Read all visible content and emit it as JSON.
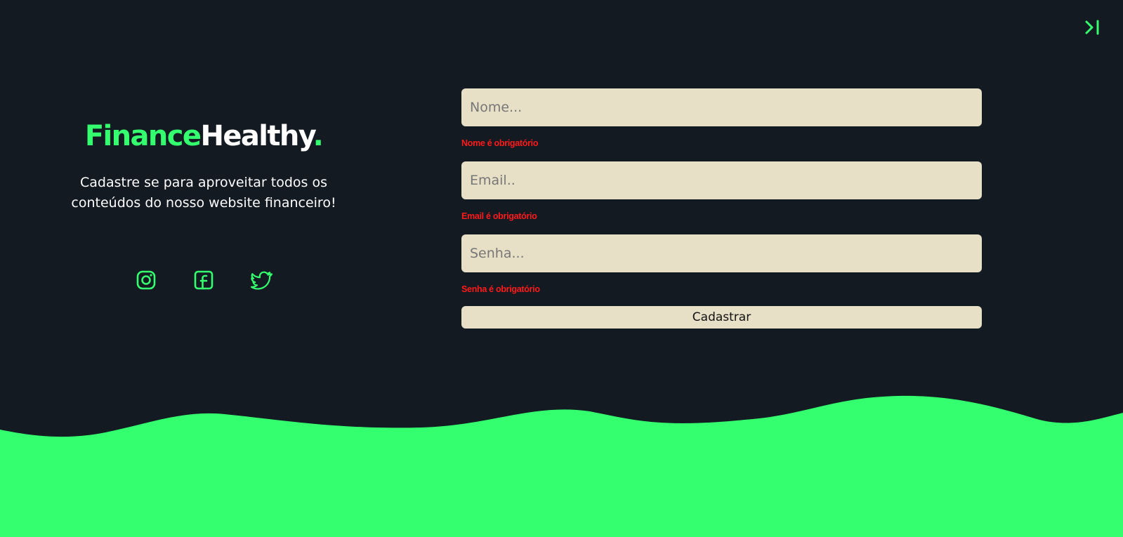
{
  "brand": {
    "part1": "Finance",
    "part2": "Healthy",
    "dot": "."
  },
  "tagline": "Cadastre se para aproveitar todos os conteúdos do nosso website financeiro!",
  "social": [
    "instagram-icon",
    "facebook-icon",
    "twitter-icon"
  ],
  "form": {
    "name_placeholder": "Nome...",
    "name_error": "Nome é obrigatório",
    "email_placeholder": "Email..",
    "email_error": "Email é obrigatório",
    "password_placeholder": "Senha...",
    "password_error": "Senha é obrigatório",
    "submit_label": "Cadastrar"
  },
  "colors": {
    "background": "#131a22",
    "accent": "#34ff6e",
    "input_bg": "#e7dfc6",
    "error": "#ff1a1a"
  },
  "icons": {
    "top_right": "collapse-right-icon"
  }
}
